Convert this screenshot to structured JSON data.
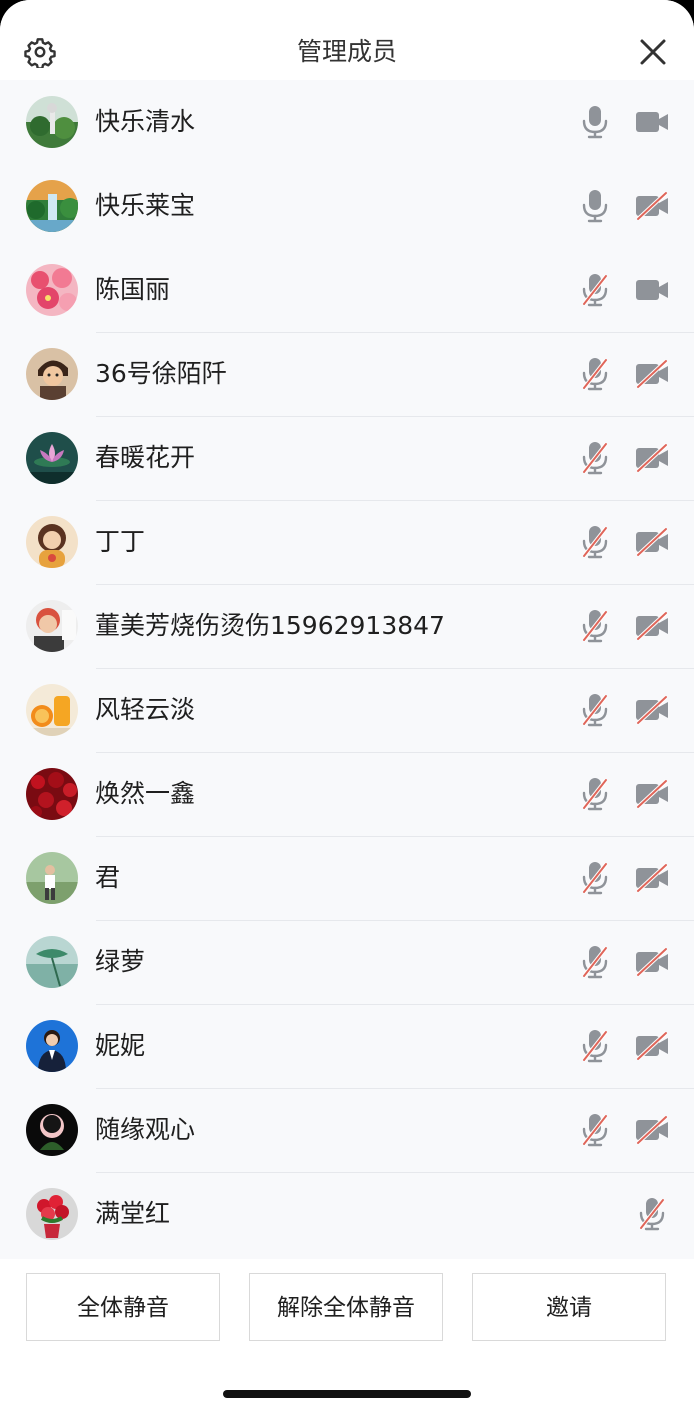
{
  "header": {
    "title": "管理成员"
  },
  "members": [
    {
      "name": "快乐清水",
      "mic": "on",
      "camera": "on",
      "avatar": "avatar-greenery"
    },
    {
      "name": "快乐莱宝",
      "mic": "on",
      "camera": "off",
      "avatar": "avatar-waterfall"
    },
    {
      "name": "陈国丽",
      "mic": "off",
      "camera": "on",
      "avatar": "avatar-pink-flowers"
    },
    {
      "name": "36号徐陌阡",
      "mic": "off",
      "camera": "off",
      "avatar": "avatar-cartoon-man"
    },
    {
      "name": "春暖花开",
      "mic": "off",
      "camera": "off",
      "avatar": "avatar-lotus"
    },
    {
      "name": "丁丁",
      "mic": "off",
      "camera": "off",
      "avatar": "avatar-cartoon-girl"
    },
    {
      "name": "董美芳烧伤烫伤15962913847",
      "mic": "off",
      "camera": "off",
      "avatar": "avatar-woman"
    },
    {
      "name": "风轻云淡",
      "mic": "off",
      "camera": "off",
      "avatar": "avatar-orange"
    },
    {
      "name": "焕然一鑫",
      "mic": "off",
      "camera": "off",
      "avatar": "avatar-red-roses"
    },
    {
      "name": "君",
      "mic": "off",
      "camera": "off",
      "avatar": "avatar-person-outdoor"
    },
    {
      "name": "绿萝",
      "mic": "off",
      "camera": "off",
      "avatar": "avatar-green-leaf"
    },
    {
      "name": "妮妮",
      "mic": "off",
      "camera": "off",
      "avatar": "avatar-business-woman"
    },
    {
      "name": "随缘观心",
      "mic": "off",
      "camera": "off",
      "avatar": "avatar-silhouette"
    },
    {
      "name": "满堂红",
      "mic": "off",
      "camera": "none",
      "avatar": "avatar-red-potted-flower"
    }
  ],
  "footer": {
    "mute_all_label": "全体静音",
    "unmute_all_label": "解除全体静音",
    "invite_label": "邀请"
  },
  "colors": {
    "icon_gray": "#8f9399",
    "disabled_slash": "#e0665a",
    "list_bg": "#f8f9fb"
  }
}
